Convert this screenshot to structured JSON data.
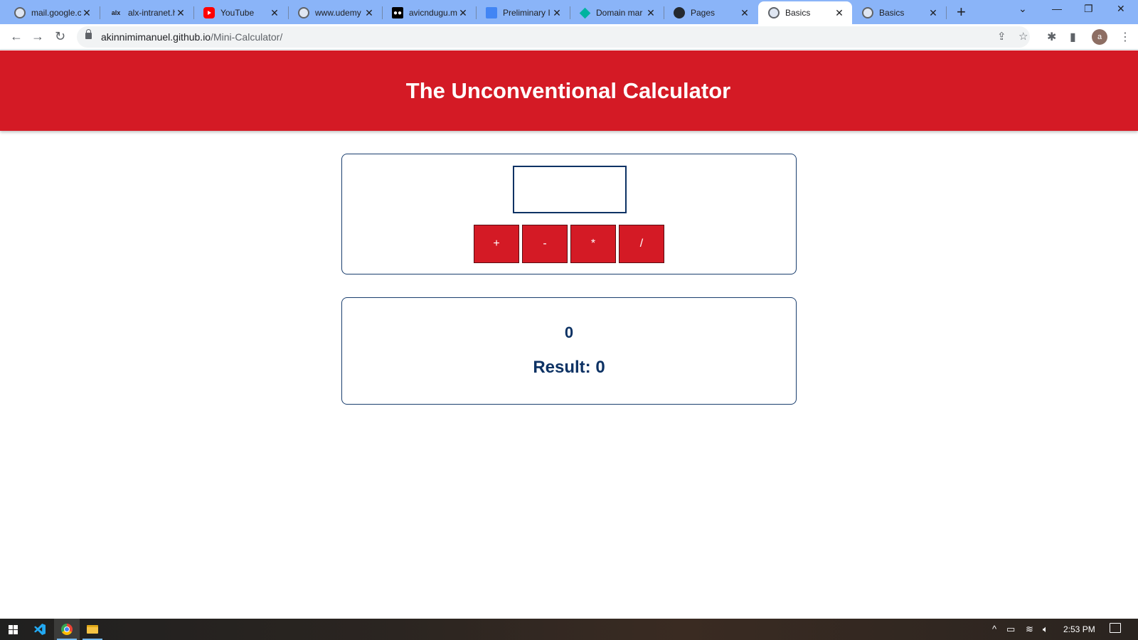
{
  "browser": {
    "tabs": [
      {
        "title": "mail.google.c",
        "favicon": "globe-icon"
      },
      {
        "title": "alx-intranet.h",
        "favicon": "alx-icon",
        "favicon_text": "alx"
      },
      {
        "title": "YouTube",
        "favicon": "youtube-icon"
      },
      {
        "title": "www.udemy",
        "favicon": "globe-icon"
      },
      {
        "title": "avicndugu.m",
        "favicon": "medium-icon",
        "favicon_text": "●●"
      },
      {
        "title": "Preliminary I",
        "favicon": "docs-icon"
      },
      {
        "title": "Domain mar",
        "favicon": "diamond-icon"
      },
      {
        "title": "Pages",
        "favicon": "github-icon"
      },
      {
        "title": "Basics",
        "favicon": "globe-icon",
        "active": true
      },
      {
        "title": "Basics",
        "favicon": "globe-icon"
      }
    ],
    "new_tab": "+",
    "url_host": "akinnimimanuel.github.io",
    "url_path": "/Mini-Calculator/",
    "profile_initial": "a"
  },
  "page": {
    "title": "The Unconventional Calculator",
    "input_value": "",
    "operators": [
      "+",
      "-",
      "*",
      "/"
    ],
    "current_value": "0",
    "result_label": "Result: 0"
  },
  "taskbar": {
    "time": "2:53 PM"
  },
  "colors": {
    "header_red": "#d41a25",
    "navy": "#0d3264",
    "tab_strip": "#8ab4f8"
  }
}
